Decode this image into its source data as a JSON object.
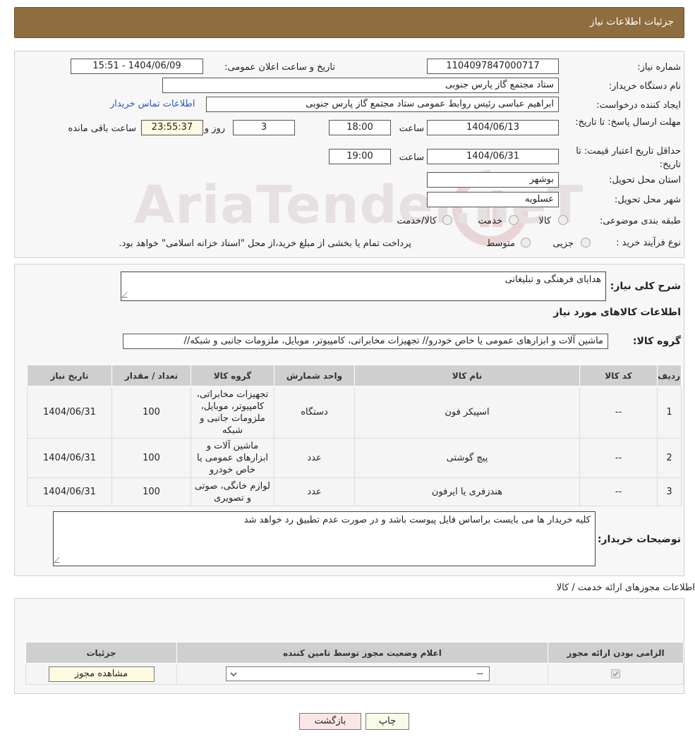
{
  "header": {
    "title": "جزئیات اطلاعات نیاز"
  },
  "watermark": {
    "text": "AriaTender.neT"
  },
  "need": {
    "need_number_label": "شماره نیاز:",
    "need_number": "1104097847000717",
    "announce_label": "تاریخ و ساعت اعلان عمومی:",
    "announce_value": "1404/06/09 - 15:51",
    "buyer_org_label": "نام دستگاه خریدار:",
    "buyer_org": "ستاد مجتمع گاز پارس جنوبی",
    "creator_label": "ایجاد کننده درخواست:",
    "creator": "ابراهیم عباسی رئیس روابط عمومی ستاد مجتمع گاز پارس جنوبی",
    "contact_link": "اطلاعات تماس خریدار",
    "deadline_label": "مهلت ارسال پاسخ: تا تاریخ:",
    "deadline_date": "1404/06/13",
    "time_label": "ساعت",
    "deadline_time": "18:00",
    "days_value": "3",
    "days_label": "روز و",
    "remaining_time": "23:55:37",
    "remaining_label": "ساعت باقی مانده",
    "validity_label": "حداقل تاریخ اعتبار قیمت: تا تاریخ:",
    "validity_date": "1404/06/31",
    "validity_time": "19:00",
    "province_label": "استان محل تحویل:",
    "province": "بوشهر",
    "city_label": "شهر محل تحویل:",
    "city": "عسلویه",
    "category_label": "طبقه بندی موضوعی:",
    "category_options": [
      "کالا",
      "خدمت",
      "کالا/خدمت"
    ],
    "process_label": "نوع فرآیند خرید :",
    "process_options": [
      "جزیی",
      "متوسط"
    ],
    "process_note": "پرداخت تمام یا بخشی از مبلغ خرید،از محل \"اسناد خزانه اسلامی\" خواهد بود."
  },
  "details": {
    "summary_label": "شرح کلی نیاز:",
    "summary": "هدایای فرهنگی و تبلیغاتی",
    "goods_heading": "اطلاعات کالاهای مورد نیاز",
    "goods_group_label": "گروه کالا:",
    "goods_group": "ماشین آلات و ابزارهای عمومی یا خاص خودرو// تجهیزات مخابراتی، کامپیوتر، موبایل، ملزومات جانبی و شبکه//",
    "table_headers": [
      "ردیف",
      "کد کالا",
      "نام کالا",
      "واحد شمارش",
      "گروه کالا",
      "تعداد / مقدار",
      "تاریخ نیاز"
    ],
    "rows": [
      {
        "row": "1",
        "code": "--",
        "name": "اسپیکر فون",
        "unit": "دستگاه",
        "group": "تجهیزات مخابراتی، کامپیوتر، موبایل، ملزومات جانبی و شبکه",
        "qty": "100",
        "date": "1404/06/31"
      },
      {
        "row": "2",
        "code": "--",
        "name": "پیچ گوشتی",
        "unit": "عدد",
        "group": "ماشین آلات و ابزارهای عمومی یا خاص خودرو",
        "qty": "100",
        "date": "1404/06/31"
      },
      {
        "row": "3",
        "code": "--",
        "name": "هندزفری یا ایرفون",
        "unit": "عدد",
        "group": "لوازم خانگی، صوتی و تصویری",
        "qty": "100",
        "date": "1404/06/31"
      }
    ],
    "buyer_notes_label": "توضیحات خریدار:",
    "buyer_notes": "کلیه خریدار ها می بایست براساس فایل پیوست باشد و در صورت  عدم تطبیق رد خواهد شد"
  },
  "permits": {
    "title": "اطلاعات مجوزهای ارائه خدمت / کالا",
    "headers": [
      "الزامی بودن ارائه مجوز",
      "اعلام وضعیت مجوز توسط تامین کننده",
      "جزئیات"
    ],
    "select_value": "--",
    "view_button": "مشاهده مجوز"
  },
  "actions": {
    "print": "چاپ",
    "back": "بازگشت"
  }
}
